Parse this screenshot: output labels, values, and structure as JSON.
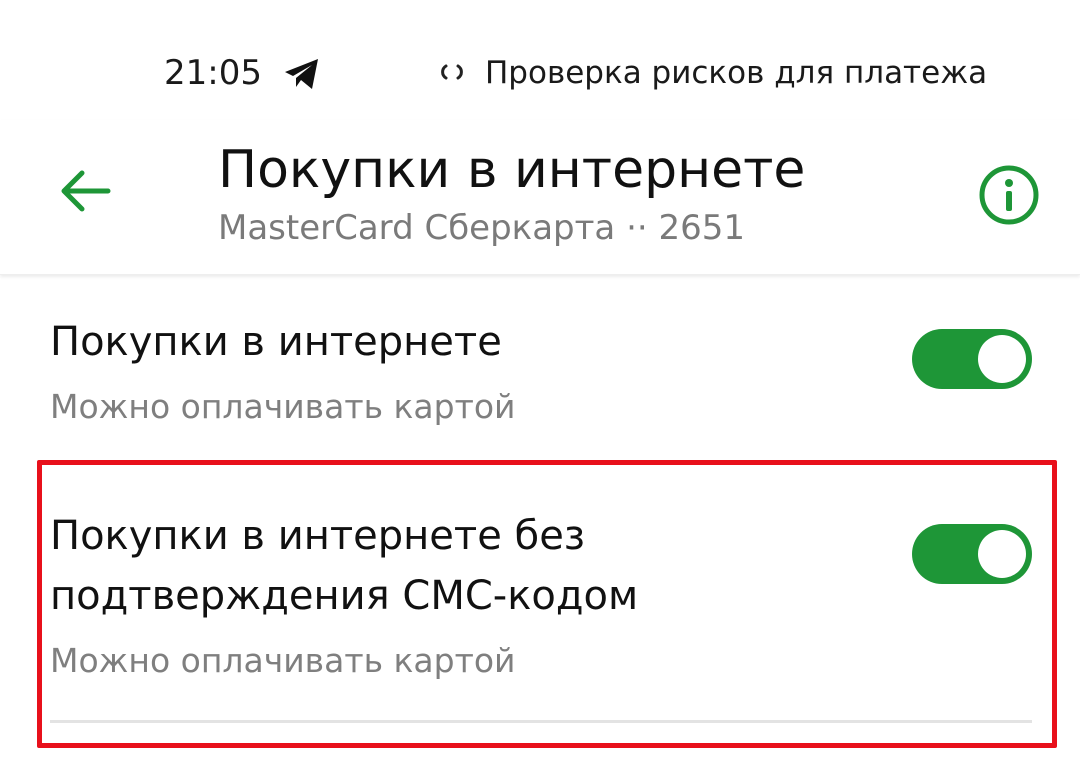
{
  "status_bar": {
    "time": "21:05",
    "activity_text": "Проверка рисков для платежа",
    "icons": [
      "telegram-icon",
      "loading-icon"
    ]
  },
  "header": {
    "title": "Покупки в интернете",
    "subtitle": "MasterCard Сберкарта ·· 2651",
    "back_icon": "arrow-left-icon",
    "info_icon": "info-icon",
    "accent_color": "#1e9637"
  },
  "settings": [
    {
      "title": "Покупки в интернете",
      "subtitle": "Можно оплачивать картой",
      "enabled": true
    },
    {
      "title": "Покупки в интернете без подтверждения СМС-кодом",
      "subtitle": "Можно оплачивать картой",
      "enabled": true,
      "highlighted": true
    }
  ],
  "colors": {
    "toggle_on": "#1e9637",
    "highlight_border": "#e8101b",
    "secondary_text": "#7f7f7f"
  }
}
